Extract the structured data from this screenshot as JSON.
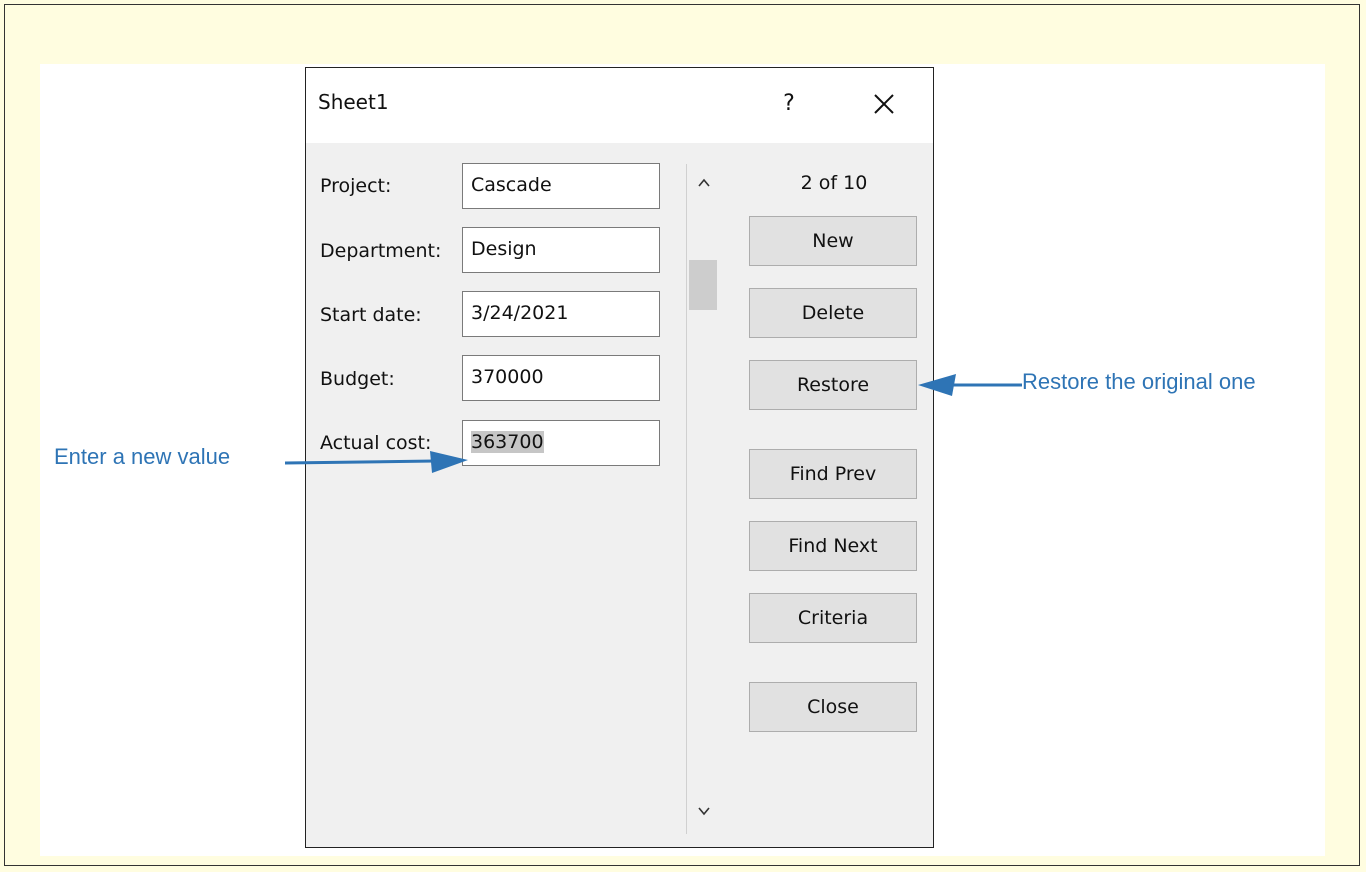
{
  "dialog": {
    "title": "Sheet1",
    "help_label": "?",
    "record_counter": "2 of 10",
    "fields": [
      {
        "label": "Project:",
        "value": "Cascade"
      },
      {
        "label": "Department:",
        "value": "Design"
      },
      {
        "label": "Start date:",
        "value": "3/24/2021"
      },
      {
        "label": "Budget:",
        "value": "370000"
      },
      {
        "label": "Actual cost:",
        "value": "363700"
      }
    ],
    "buttons": {
      "new": "New",
      "delete": "Delete",
      "restore": "Restore",
      "find_prev": "Find Prev",
      "find_next": "Find Next",
      "criteria": "Criteria",
      "close": "Close"
    }
  },
  "annotations": {
    "left": "Enter a new value",
    "right": "Restore the original one",
    "color": "#2e74b5"
  },
  "icons": {
    "close": "close-icon",
    "scroll_up": "chevron-up-icon",
    "scroll_down": "chevron-down-icon"
  }
}
